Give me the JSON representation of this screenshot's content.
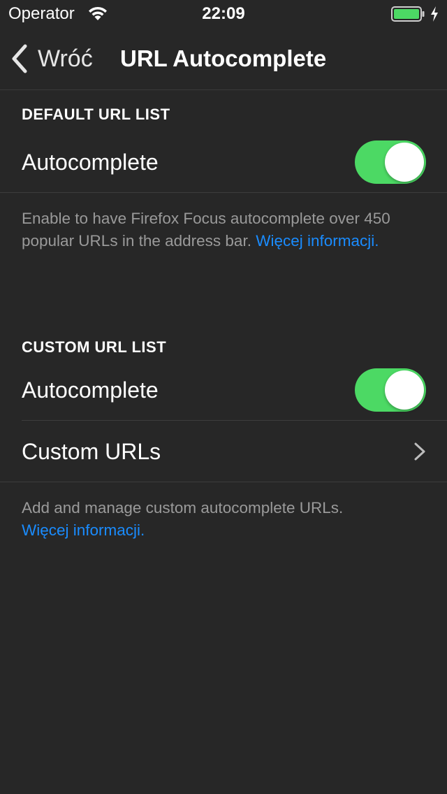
{
  "status_bar": {
    "carrier": "Operator",
    "time": "22:09",
    "battery_level": 1.0
  },
  "nav": {
    "back_label": "Wróć",
    "title": "URL Autocomplete"
  },
  "default_section": {
    "header": "DEFAULT URL LIST",
    "autocomplete_label": "Autocomplete",
    "autocomplete_on": true,
    "footer_text": "Enable to have Firefox Focus autocomplete over 450 popular URLs in the address bar.",
    "footer_link": "Więcej informacji."
  },
  "custom_section": {
    "header": "CUSTOM URL LIST",
    "autocomplete_label": "Autocomplete",
    "autocomplete_on": true,
    "custom_urls_label": "Custom URLs",
    "footer_text": "Add and manage custom autocomplete URLs.",
    "footer_link": "Więcej informacji."
  },
  "colors": {
    "background": "#272727",
    "toggle_on": "#4cd964",
    "link": "#1a8cff",
    "footer_text": "#9a9a9a"
  }
}
